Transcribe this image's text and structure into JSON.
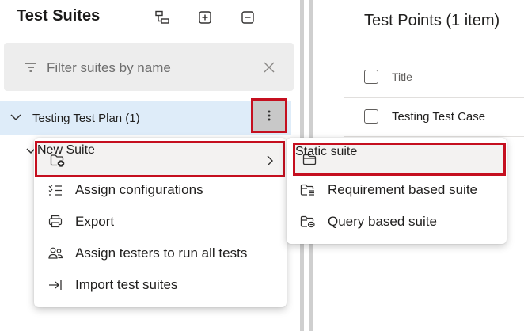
{
  "left_panel": {
    "title": "Test Suites",
    "toolbar_icons": [
      "hierarchy-icon",
      "expand-all-icon",
      "collapse-all-icon"
    ],
    "filter": {
      "placeholder": "Filter suites by name"
    },
    "tree": {
      "root_label": "Testing Test Plan (1)"
    }
  },
  "right_panel": {
    "title": "Test Points (1 item)",
    "column_title": "Title",
    "rows": [
      {
        "title": "Testing Test Case"
      }
    ]
  },
  "context_menu": {
    "items": [
      {
        "label": "New Suite",
        "icon": "new-folder-icon",
        "submenu": true
      },
      {
        "label": "Assign configurations",
        "icon": "checklist-icon"
      },
      {
        "label": "Export",
        "icon": "printer-icon"
      },
      {
        "label": "Assign testers to run all tests",
        "icon": "people-icon"
      },
      {
        "label": "Import test suites",
        "icon": "import-icon"
      }
    ]
  },
  "submenu": {
    "items": [
      {
        "label": "Static suite",
        "icon": "folder-icon"
      },
      {
        "label": "Requirement based suite",
        "icon": "folder-list-icon"
      },
      {
        "label": "Query based suite",
        "icon": "folder-query-icon"
      }
    ]
  },
  "colors": {
    "highlight_border": "#c50f1f",
    "selected_row": "#deecf9"
  }
}
